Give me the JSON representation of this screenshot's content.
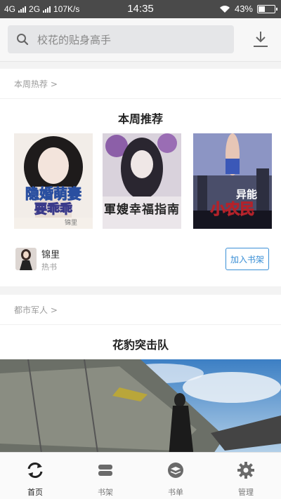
{
  "status_bar": {
    "net1": "4G",
    "net2": "2G",
    "speed": "107K/s",
    "time": "14:35",
    "battery_text": "43%",
    "battery_level": 0.43
  },
  "search": {
    "placeholder": "校花的贴身高手"
  },
  "section_weekly": {
    "tag": "本周热荐 >",
    "title": "本周推荐",
    "books": [
      {
        "cover_title_a": "隐婚",
        "cover_title_b": "萌妻",
        "cover_title_c": "要乖乖",
        "cover_author": "锦里"
      },
      {
        "cover_title_a": "軍嫂",
        "cover_title_b": "幸福指南",
        "cover_title_c": "",
        "cover_author": ""
      },
      {
        "cover_title_a": "异能",
        "cover_title_b": "小农民",
        "cover_title_c": "",
        "cover_author": ""
      }
    ],
    "author": {
      "name": "锦里",
      "subtitle": "热书"
    },
    "add_button": "加入书架"
  },
  "section_urban": {
    "tag": "都市军人 >",
    "title": "花豹突击队"
  },
  "bottom_nav": {
    "items": [
      {
        "label": "首页",
        "icon": "refresh-icon",
        "active": true
      },
      {
        "label": "书架",
        "icon": "bookshelf-icon",
        "active": false
      },
      {
        "label": "书单",
        "icon": "booklist-icon",
        "active": false
      },
      {
        "label": "管理",
        "icon": "gear-icon",
        "active": false
      }
    ]
  },
  "colors": {
    "accent": "#3a8fd6",
    "status_bar": "#4a4a4a"
  }
}
